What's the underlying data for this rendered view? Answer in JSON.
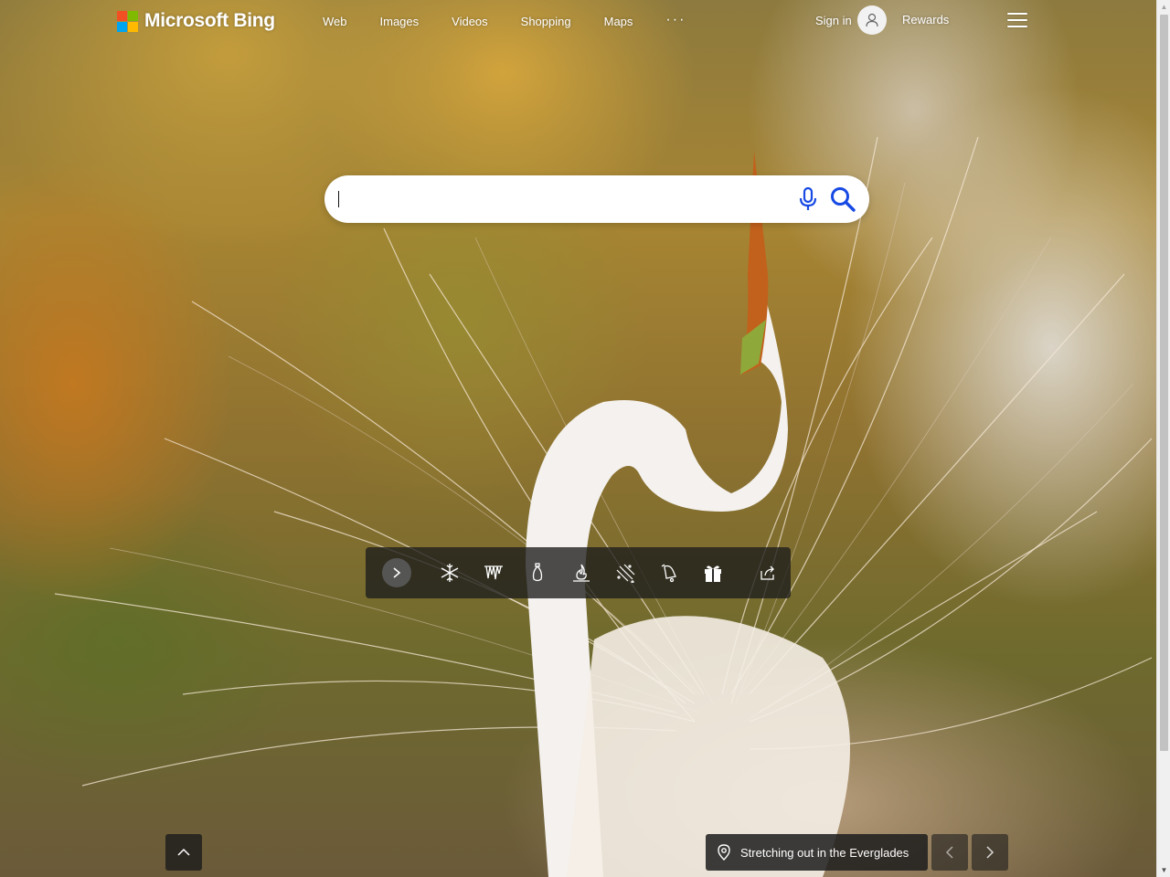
{
  "brand": {
    "name": "Microsoft Bing"
  },
  "nav": {
    "items": [
      {
        "label": "Web"
      },
      {
        "label": "Images"
      },
      {
        "label": "Videos"
      },
      {
        "label": "Shopping"
      },
      {
        "label": "Maps"
      }
    ],
    "more_label": "···"
  },
  "header": {
    "signin_label": "Sign in",
    "rewards_label": "Rewards"
  },
  "search": {
    "value": "",
    "placeholder": ""
  },
  "theme_bar": {
    "icons": [
      "snowflake-icon",
      "icicles-icon",
      "ornament-icon",
      "campfire-icon",
      "snowfall-icon",
      "bells-icon",
      "gift-icon",
      "share-icon"
    ]
  },
  "image": {
    "caption": "Stretching out in the Everglades"
  },
  "colors": {
    "ms_red": "#f25022",
    "ms_green": "#7fba00",
    "ms_blue": "#00a4ef",
    "ms_yellow": "#ffb900",
    "search_icon_blue": "#174ae4"
  }
}
